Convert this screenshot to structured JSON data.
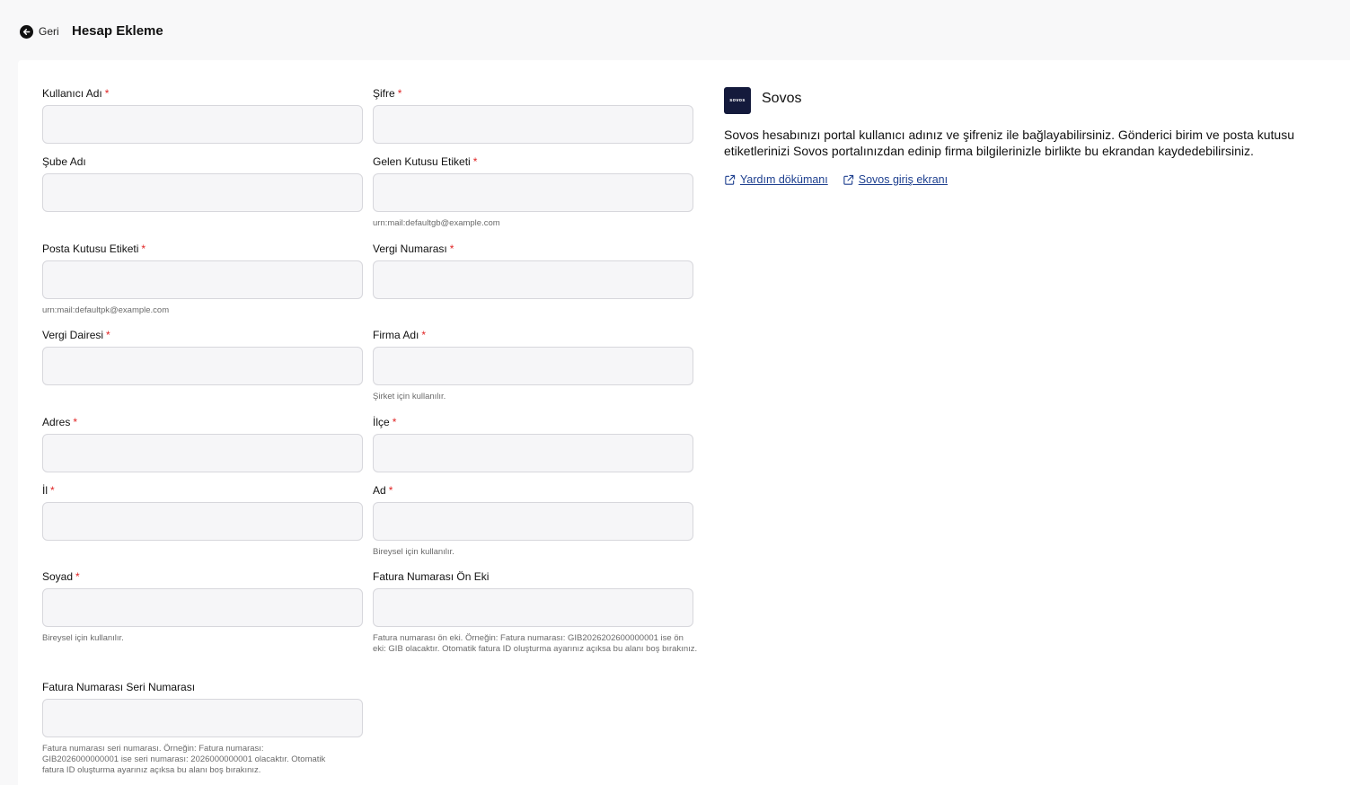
{
  "header": {
    "back_label": "Geri",
    "title": "Hesap Ekleme"
  },
  "form": {
    "kullanici_adi": {
      "label": "Kullanıcı Adı",
      "required": "*",
      "value": ""
    },
    "sifre": {
      "label": "Şifre",
      "required": "*",
      "value": ""
    },
    "sube_adi": {
      "label": "Şube Adı",
      "value": ""
    },
    "gelen_kutusu_etiketi": {
      "label": "Gelen Kutusu Etiketi",
      "required": "*",
      "value": "",
      "hint": "urn:mail:defaultgb@example.com"
    },
    "posta_kutusu_etiketi": {
      "label": "Posta Kutusu Etiketi",
      "required": "*",
      "value": "",
      "hint": "urn:mail:defaultpk@example.com"
    },
    "vergi_numarasi": {
      "label": "Vergi Numarası",
      "required": "*",
      "value": ""
    },
    "vergi_dairesi": {
      "label": "Vergi Dairesi",
      "required": "*",
      "value": ""
    },
    "firma_adi": {
      "label": "Firma Adı",
      "required": "*",
      "value": "",
      "hint": "Şirket için kullanılır."
    },
    "adres": {
      "label": "Adres",
      "required": "*",
      "value": ""
    },
    "ilce": {
      "label": "İlçe",
      "required": "*",
      "value": ""
    },
    "il": {
      "label": "İl",
      "required": "*",
      "value": ""
    },
    "ad": {
      "label": "Ad",
      "required": "*",
      "value": "",
      "hint": "Bireysel için kullanılır."
    },
    "soyad": {
      "label": "Soyad",
      "required": "*",
      "value": "",
      "hint": "Bireysel için kullanılır."
    },
    "fatura_on_eki": {
      "label": "Fatura Numarası Ön Eki",
      "value": "",
      "hint": "Fatura numarası ön eki. Örneğin: Fatura numarası: GIB2026202600000001 ise ön eki: GIB olacaktır. Otomatik fatura ID oluşturma ayarınız açıksa bu alanı boş bırakınız."
    },
    "fatura_seri": {
      "label": "Fatura Numarası Seri Numarası",
      "value": "",
      "hint": "Fatura numarası seri numarası. Örneğin: Fatura numarası: GIB2026000000001 ise seri numarası: 2026000000001 olacaktır. Otomatik fatura ID oluşturma ayarınız açıksa bu alanı boş bırakınız."
    }
  },
  "provider": {
    "logo_text": "sovos",
    "name": "Sovos",
    "description": "Sovos hesabınızı portal kullanıcı adınız ve şifreniz ile bağlayabilirsiniz. Gönderici birim ve posta kutusu etiketlerinizi Sovos portalınızdan edinip firma bilgilerinizle birlikte bu ekrandan kaydedebilirsiniz.",
    "links": [
      {
        "label": "Yardım dökümanı",
        "icon": "external-link-icon"
      },
      {
        "label": "Sovos giriş ekranı",
        "icon": "external-link-icon"
      }
    ]
  },
  "colors": {
    "page_bg": "#f8f8f9",
    "card_bg": "#ffffff",
    "input_bg": "#f6f6f8",
    "input_border": "#d7d7dc",
    "required": "#e02424",
    "link": "#1d3f8f",
    "logo_bg": "#141a3c"
  }
}
